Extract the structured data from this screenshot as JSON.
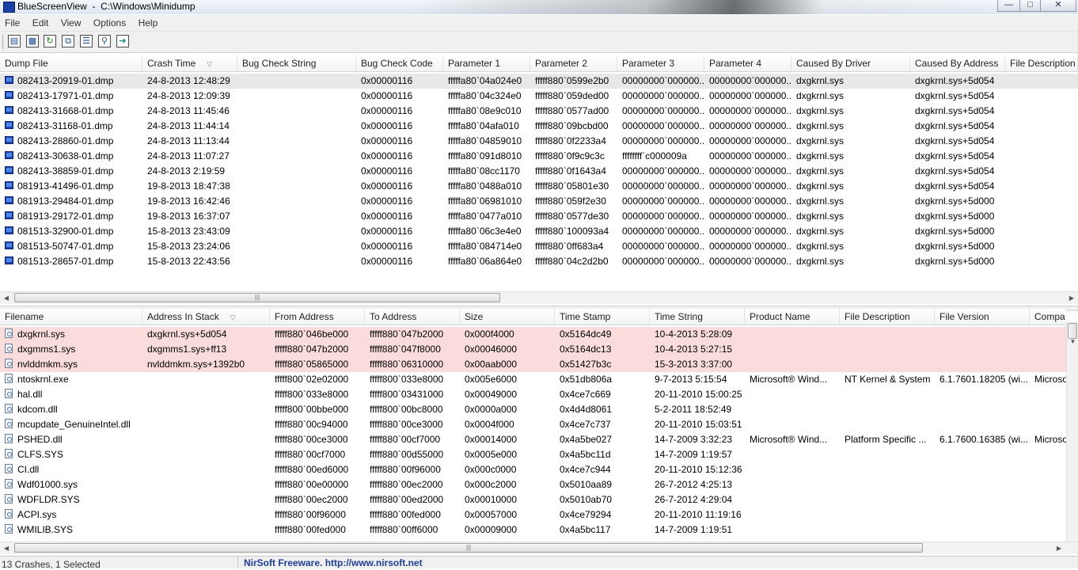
{
  "window": {
    "title": "BlueScreenView  -  C:\\Windows\\Minidump",
    "minimize_icon": "minimize-icon",
    "maximize_icon": "maximize-icon",
    "close_icon": "close-icon"
  },
  "menu": [
    "File",
    "Edit",
    "View",
    "Options",
    "Help"
  ],
  "toolbar": [
    "html-report-icon",
    "save-icon",
    "refresh-icon",
    "copy-icon",
    "properties-icon",
    "find-icon",
    "exit-icon"
  ],
  "upper": {
    "columns": [
      "Dump File",
      "Crash Time",
      "Bug Check String",
      "Bug Check Code",
      "Parameter 1",
      "Parameter 2",
      "Parameter 3",
      "Parameter 4",
      "Caused By Driver",
      "Caused By Address",
      "File Description"
    ],
    "rows": [
      [
        "082413-20919-01.dmp",
        "24-8-2013 12:48:29",
        "",
        "0x00000116",
        "fffffa80`04a024e0",
        "fffff880`0599e2b0",
        "00000000`000000...",
        "00000000`000000...",
        "dxgkrnl.sys",
        "dxgkrnl.sys+5d054",
        ""
      ],
      [
        "082413-17971-01.dmp",
        "24-8-2013 12:09:39",
        "",
        "0x00000116",
        "fffffa80`04c324e0",
        "fffff880`059ded00",
        "00000000`000000...",
        "00000000`000000...",
        "dxgkrnl.sys",
        "dxgkrnl.sys+5d054",
        ""
      ],
      [
        "082413-31668-01.dmp",
        "24-8-2013 11:45:46",
        "",
        "0x00000116",
        "fffffa80`08e9c010",
        "fffff880`0577ad00",
        "00000000`000000...",
        "00000000`000000...",
        "dxgkrnl.sys",
        "dxgkrnl.sys+5d054",
        ""
      ],
      [
        "082413-31168-01.dmp",
        "24-8-2013 11:44:14",
        "",
        "0x00000116",
        "fffffa80`04afa010",
        "fffff880`09bcbd00",
        "00000000`000000...",
        "00000000`000000...",
        "dxgkrnl.sys",
        "dxgkrnl.sys+5d054",
        ""
      ],
      [
        "082413-28860-01.dmp",
        "24-8-2013 11:13:44",
        "",
        "0x00000116",
        "fffffa80`04859010",
        "fffff880`0f2233a4",
        "00000000`000000...",
        "00000000`000000...",
        "dxgkrnl.sys",
        "dxgkrnl.sys+5d054",
        ""
      ],
      [
        "082413-30638-01.dmp",
        "24-8-2013 11:07:27",
        "",
        "0x00000116",
        "fffffa80`091d8010",
        "fffff880`0f9c9c3c",
        "ffffffff`c000009a",
        "00000000`000000...",
        "dxgkrnl.sys",
        "dxgkrnl.sys+5d054",
        ""
      ],
      [
        "082413-38859-01.dmp",
        "24-8-2013 2:19:59",
        "",
        "0x00000116",
        "fffffa80`08cc1170",
        "fffff880`0f1643a4",
        "00000000`000000...",
        "00000000`000000...",
        "dxgkrnl.sys",
        "dxgkrnl.sys+5d054",
        ""
      ],
      [
        "081913-41496-01.dmp",
        "19-8-2013 18:47:38",
        "",
        "0x00000116",
        "fffffa80`0488a010",
        "fffff880`05801e30",
        "00000000`000000...",
        "00000000`000000...",
        "dxgkrnl.sys",
        "dxgkrnl.sys+5d054",
        ""
      ],
      [
        "081913-29484-01.dmp",
        "19-8-2013 16:42:46",
        "",
        "0x00000116",
        "fffffa80`06981010",
        "fffff880`059f2e30",
        "00000000`000000...",
        "00000000`000000...",
        "dxgkrnl.sys",
        "dxgkrnl.sys+5d000",
        ""
      ],
      [
        "081913-29172-01.dmp",
        "19-8-2013 16:37:07",
        "",
        "0x00000116",
        "fffffa80`0477a010",
        "fffff880`0577de30",
        "00000000`000000...",
        "00000000`000000...",
        "dxgkrnl.sys",
        "dxgkrnl.sys+5d000",
        ""
      ],
      [
        "081513-32900-01.dmp",
        "15-8-2013 23:43:09",
        "",
        "0x00000116",
        "fffffa80`06c3e4e0",
        "fffff880`100093a4",
        "00000000`000000...",
        "00000000`000000...",
        "dxgkrnl.sys",
        "dxgkrnl.sys+5d000",
        ""
      ],
      [
        "081513-50747-01.dmp",
        "15-8-2013 23:24:06",
        "",
        "0x00000116",
        "fffffa80`084714e0",
        "fffff880`0ff683a4",
        "00000000`000000...",
        "00000000`000000...",
        "dxgkrnl.sys",
        "dxgkrnl.sys+5d000",
        ""
      ],
      [
        "081513-28657-01.dmp",
        "15-8-2013 22:43:56",
        "",
        "0x00000116",
        "fffffa80`06a864e0",
        "fffff880`04c2d2b0",
        "00000000`000000...",
        "00000000`000000...",
        "dxgkrnl.sys",
        "dxgkrnl.sys+5d000",
        ""
      ]
    ],
    "selected_row": 0
  },
  "lower": {
    "columns": [
      "Filename",
      "Address In Stack",
      "From Address",
      "To Address",
      "Size",
      "Time Stamp",
      "Time String",
      "Product Name",
      "File Description",
      "File Version",
      "Compa"
    ],
    "rows": [
      [
        "dxgkrnl.sys",
        "dxgkrnl.sys+5d054",
        "fffff880`046be000",
        "fffff880`047b2000",
        "0x000f4000",
        "0x5164dc49",
        "10-4-2013 5:28:09",
        "",
        "",
        "",
        ""
      ],
      [
        "dxgmms1.sys",
        "dxgmms1.sys+ff13",
        "fffff880`047b2000",
        "fffff880`047f8000",
        "0x00046000",
        "0x5164dc13",
        "10-4-2013 5:27:15",
        "",
        "",
        "",
        ""
      ],
      [
        "nvlddmkm.sys",
        "nvlddmkm.sys+1392b0",
        "fffff880`05865000",
        "fffff880`06310000",
        "0x00aab000",
        "0x51427b3c",
        "15-3-2013 3:37:00",
        "",
        "",
        "",
        ""
      ],
      [
        "ntoskrnl.exe",
        "",
        "fffff800`02e02000",
        "fffff800`033e8000",
        "0x005e6000",
        "0x51db806a",
        "9-7-2013 5:15:54",
        "Microsoft® Wind...",
        "NT Kernel & System",
        "6.1.7601.18205 (wi...",
        "Microso"
      ],
      [
        "hal.dll",
        "",
        "fffff800`033e8000",
        "fffff800`03431000",
        "0x00049000",
        "0x4ce7c669",
        "20-11-2010 15:00:25",
        "",
        "",
        "",
        ""
      ],
      [
        "kdcom.dll",
        "",
        "fffff800`00bbe000",
        "fffff800`00bc8000",
        "0x0000a000",
        "0x4d4d8061",
        "5-2-2011 18:52:49",
        "",
        "",
        "",
        ""
      ],
      [
        "mcupdate_GenuineIntel.dll",
        "",
        "fffff880`00c94000",
        "fffff880`00ce3000",
        "0x0004f000",
        "0x4ce7c737",
        "20-11-2010 15:03:51",
        "",
        "",
        "",
        ""
      ],
      [
        "PSHED.dll",
        "",
        "fffff880`00ce3000",
        "fffff880`00cf7000",
        "0x00014000",
        "0x4a5be027",
        "14-7-2009 3:32:23",
        "Microsoft® Wind...",
        "Platform Specific ...",
        "6.1.7600.16385 (wi...",
        "Microso"
      ],
      [
        "CLFS.SYS",
        "",
        "fffff880`00cf7000",
        "fffff880`00d55000",
        "0x0005e000",
        "0x4a5bc11d",
        "14-7-2009 1:19:57",
        "",
        "",
        "",
        ""
      ],
      [
        "CI.dll",
        "",
        "fffff880`00ed6000",
        "fffff880`00f96000",
        "0x000c0000",
        "0x4ce7c944",
        "20-11-2010 15:12:36",
        "",
        "",
        "",
        ""
      ],
      [
        "Wdf01000.sys",
        "",
        "fffff880`00e00000",
        "fffff880`00ec2000",
        "0x000c2000",
        "0x5010aa89",
        "26-7-2012 4:25:13",
        "",
        "",
        "",
        ""
      ],
      [
        "WDFLDR.SYS",
        "",
        "fffff880`00ec2000",
        "fffff880`00ed2000",
        "0x00010000",
        "0x5010ab70",
        "26-7-2012 4:29:04",
        "",
        "",
        "",
        ""
      ],
      [
        "ACPI.sys",
        "",
        "fffff880`00f96000",
        "fffff880`00fed000",
        "0x00057000",
        "0x4ce79294",
        "20-11-2010 11:19:16",
        "",
        "",
        "",
        ""
      ],
      [
        "WMILIB.SYS",
        "",
        "fffff880`00fed000",
        "fffff880`00ff6000",
        "0x00009000",
        "0x4a5bc117",
        "14-7-2009 1:19:51",
        "",
        "",
        "",
        ""
      ]
    ],
    "highlighted_rows": 3,
    "highlight_color": "#fadcdc"
  },
  "status": {
    "count": "13 Crashes, 1 Selected",
    "credit": "NirSoft Freeware.  http://www.nirsoft.net"
  },
  "colors": {
    "selected_row": "#e8e8e8",
    "link": "#1d3d9c"
  }
}
